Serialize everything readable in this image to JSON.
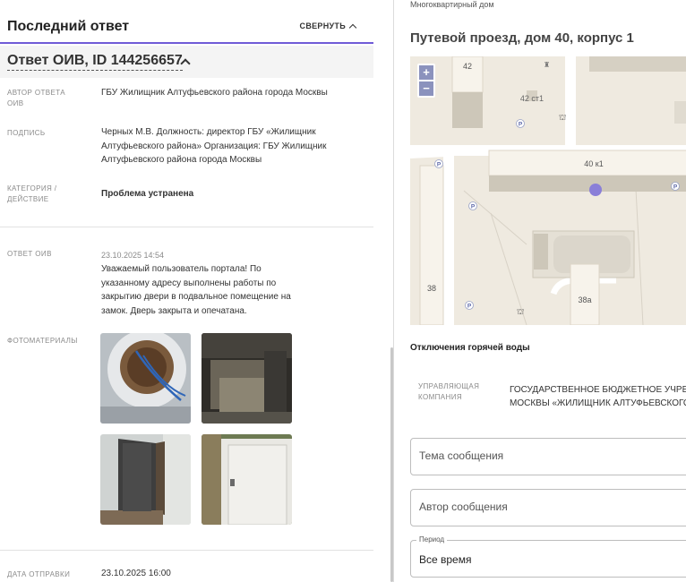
{
  "last_answer": {
    "title": "Последний ответ",
    "collapse_label": "СВЕРНУТЬ",
    "answer_heading": "Ответ ОИВ, ID 144256657",
    "author_label": "Автор ответа ОИВ",
    "author_value": "ГБУ Жилищник Алтуфьевского района города Москвы",
    "signature_label": "Подпись",
    "signature_value": "Черных М.В. Должность: директор ГБУ «Жилищник Алтуфьевского района» Организация: ГБУ Жилищник Алтуфьевского района города Москвы",
    "category_label": "Категория / действие",
    "category_value": "Проблема устранена",
    "answer_label": "Ответ ОИВ",
    "answer_timestamp": "23.10.2025 14:54",
    "answer_text": "Уважаемый пользователь портала! По указанному адресу выполнены работы по закрытию двери в подвальное помещение на замок. Дверь закрыта и опечатана.",
    "photos_label": "Фотоматериалы",
    "send_date_label": "Дата отправки",
    "send_date_value": "23.10.2025 16:00"
  },
  "building": {
    "type": "Многоквартирный дом",
    "address": "Путевой проезд, дом 40, корпус 1",
    "map": {
      "labels": [
        "42",
        "42 ст1",
        "40 к1",
        "38",
        "38а"
      ],
      "zoom_in": "+",
      "zoom_out": "−",
      "parking": "P"
    }
  },
  "hot_water": {
    "title": "Отключения горячей воды",
    "uk_label": "Управляющая компания",
    "uk_value_line1": "ГОСУДАРСТВЕННОЕ БЮДЖЕТНОЕ УЧРЕЖДЕНИЕ ГОРОДА",
    "uk_value_line2": "МОСКВЫ «ЖИЛИЩНИК АЛТУФЬЕВСКОГО РАЙОНА»"
  },
  "form": {
    "subject_placeholder": "Тема сообщения",
    "author_placeholder": "Автор сообщения",
    "period_legend": "Период",
    "period_value": "Все время"
  },
  "colors": {
    "accent": "#6f5bd7",
    "map_marker": "#8a7fd8"
  }
}
